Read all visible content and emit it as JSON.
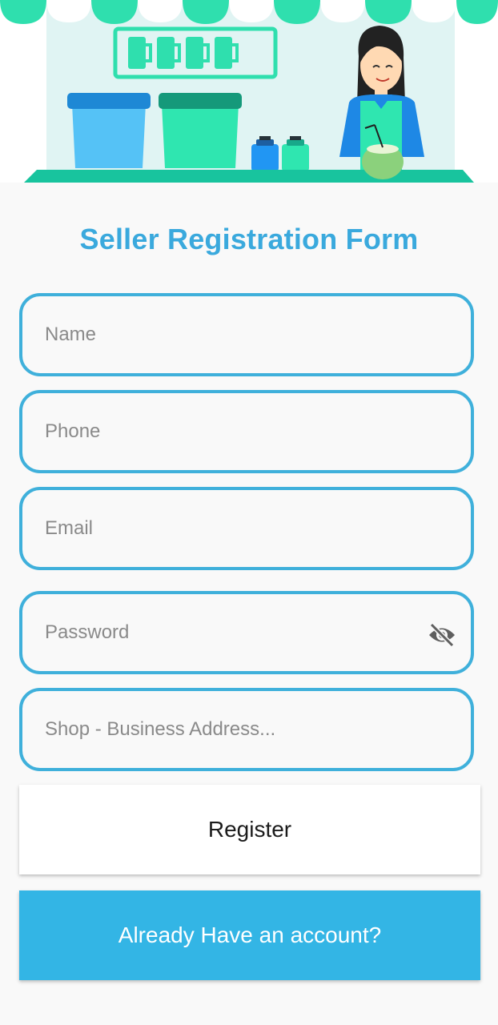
{
  "form": {
    "title": "Seller Registration Form",
    "name_placeholder": "Name",
    "phone_placeholder": "Phone",
    "email_placeholder": "Email",
    "password_placeholder": "Password",
    "address_placeholder": "Shop - Business Address...",
    "password_toggle_icon": "eye-off-icon",
    "register_label": "Register",
    "login_label": "Already Have an account?"
  },
  "colors": {
    "accent": "#3aa9dd",
    "field_border": "#3fb0db",
    "login_button": "#33b5e5",
    "background": "#f9f9f9"
  }
}
